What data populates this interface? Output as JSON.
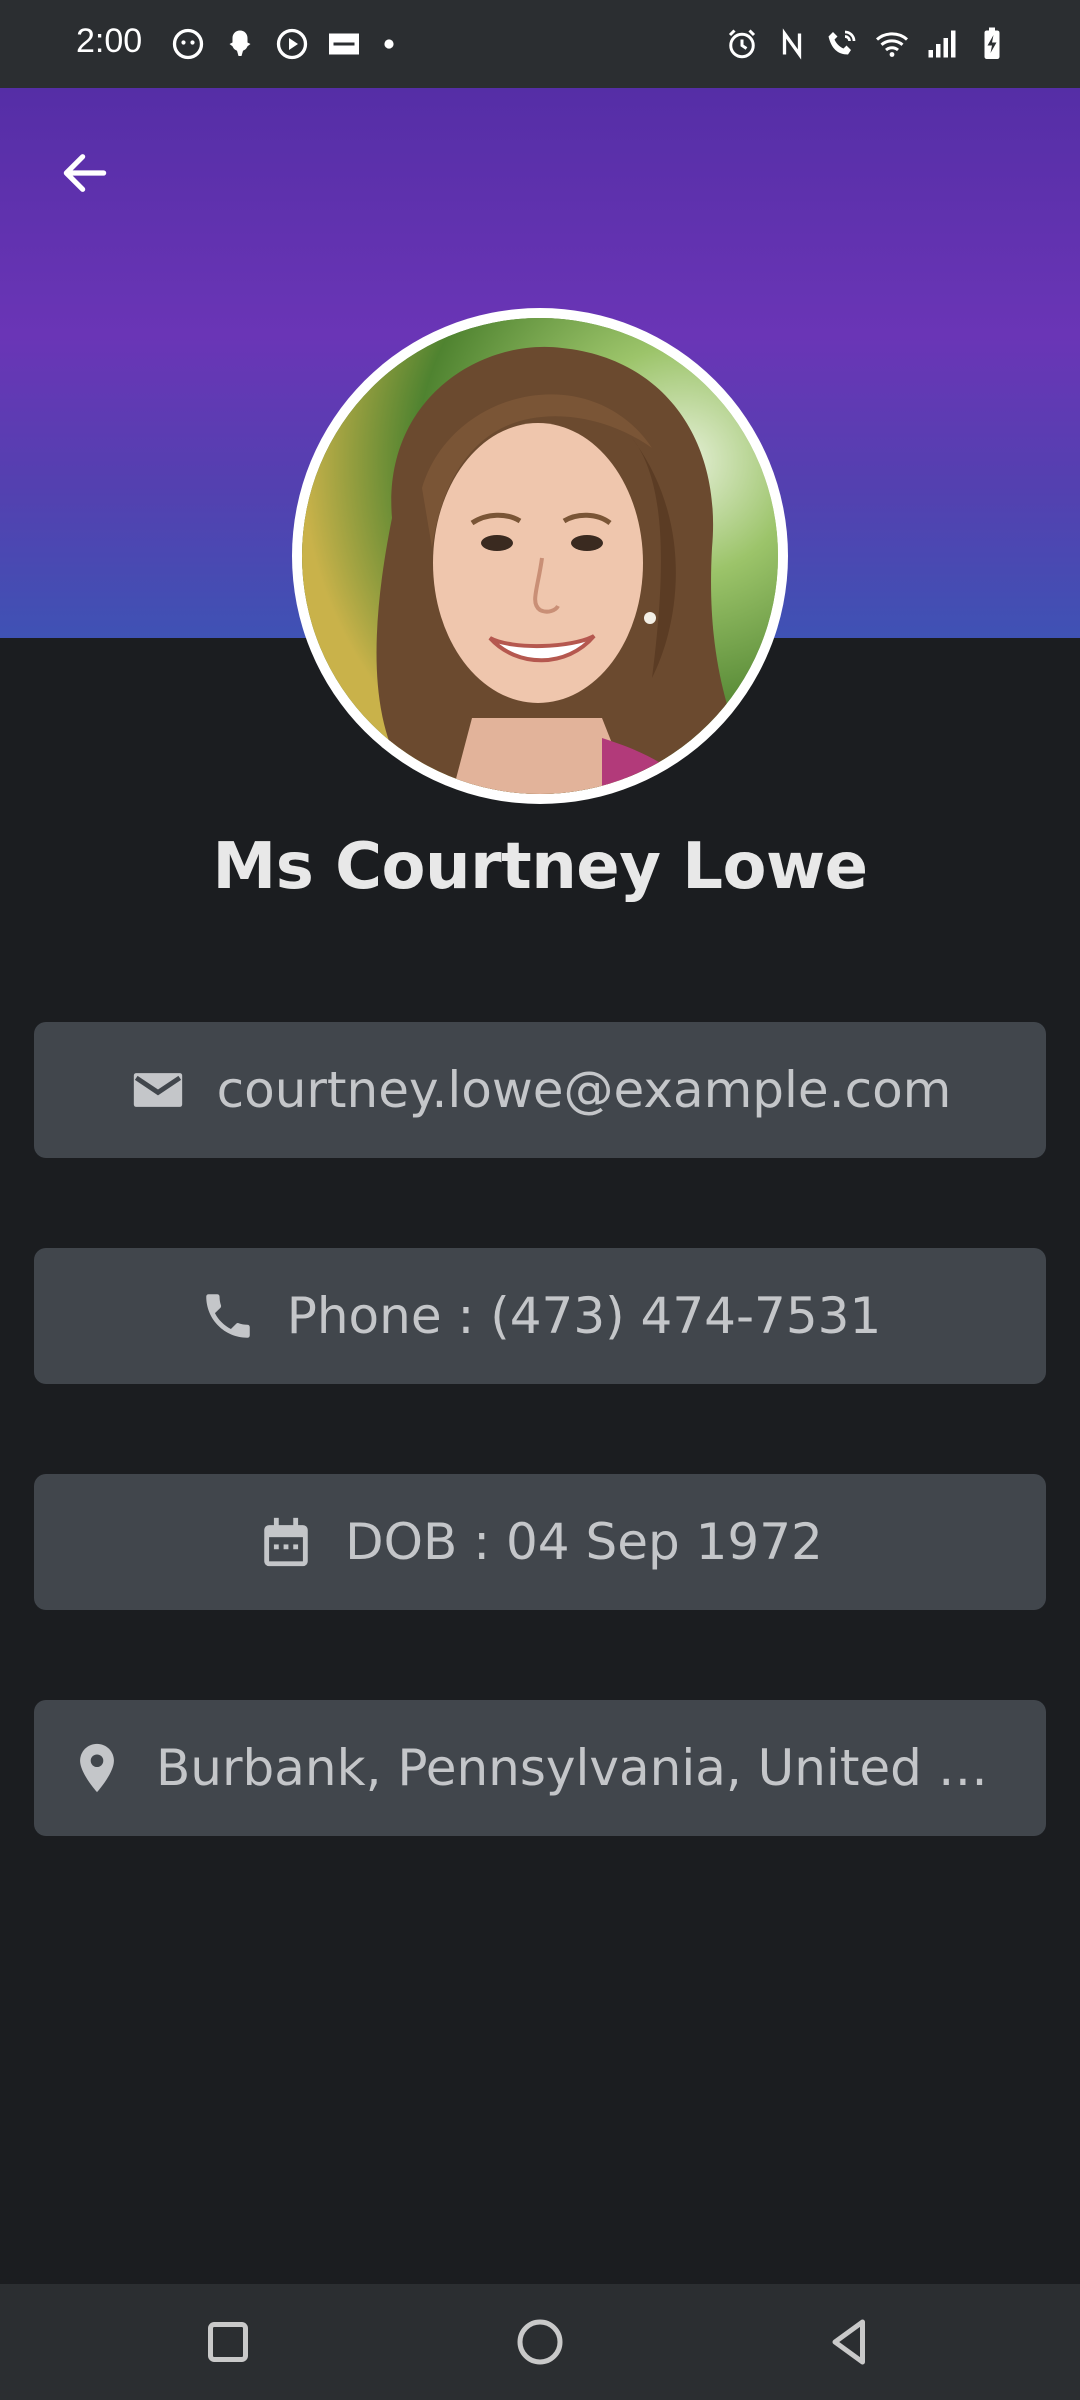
{
  "status_bar": {
    "time": "2:00",
    "left_icons": [
      "app-notification-icon",
      "snapchat-icon",
      "media-play-icon",
      "pocket-icon",
      "dot-icon"
    ],
    "right_icons": [
      "alarm-icon",
      "nfc-icon",
      "wifi-call-icon",
      "wifi-icon",
      "signal-icon",
      "battery-charging-icon"
    ]
  },
  "header": {
    "back_icon": "arrow-back-icon",
    "gradient_colors": [
      "#552ea6",
      "#6a35b6",
      "#3f52b4"
    ]
  },
  "profile": {
    "name": "Ms Courtney Lowe"
  },
  "cards": {
    "email": {
      "icon": "mail-icon",
      "text": "courtney.lowe@example.com"
    },
    "phone": {
      "icon": "phone-icon",
      "text": "Phone : (473) 474-7531"
    },
    "dob": {
      "icon": "calendar-icon",
      "text": "DOB : 04 Sep 1972"
    },
    "location": {
      "icon": "location-pin-icon",
      "text": "Burbank, Pennsylvania, United States"
    }
  },
  "nav_bar": {
    "buttons": [
      "recents-square-icon",
      "home-circle-icon",
      "back-triangle-icon"
    ]
  },
  "colors": {
    "background": "#1b1d20",
    "card": "#41464c",
    "card_text": "#c4c6c9",
    "name_text": "#e8e8e8"
  }
}
